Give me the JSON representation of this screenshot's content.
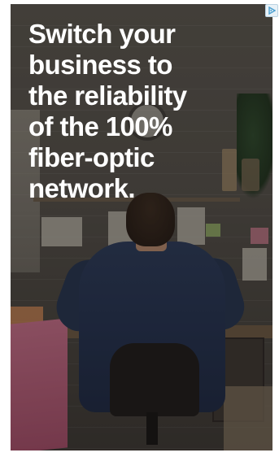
{
  "ad": {
    "headline": "Switch your\nbusiness to\nthe reliability\nof the 100%\nfiber-optic\nnetwork."
  },
  "adchoices": {
    "icon": "adchoices-icon",
    "color": "#4a9fd0"
  }
}
